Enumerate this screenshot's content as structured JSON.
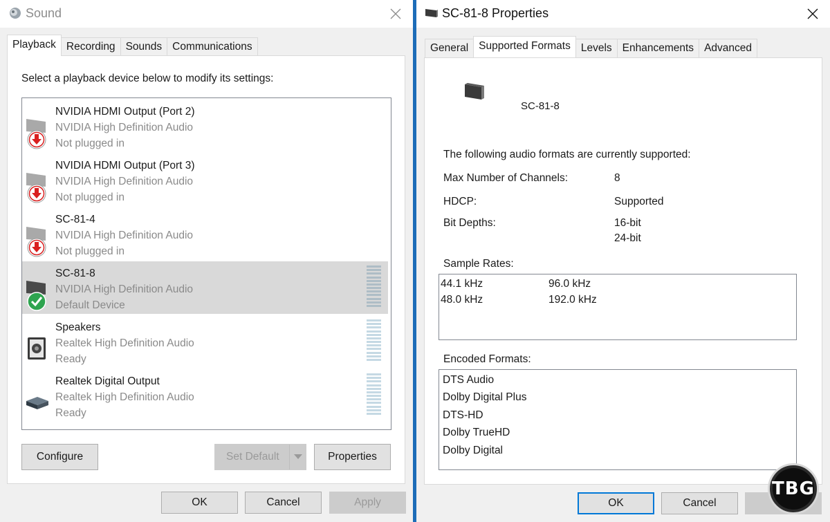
{
  "sound": {
    "title": "Sound",
    "tabs": [
      {
        "label": "Playback",
        "active": true
      },
      {
        "label": "Recording",
        "active": false
      },
      {
        "label": "Sounds",
        "active": false
      },
      {
        "label": "Communications",
        "active": false
      }
    ],
    "instruction": "Select a playback device below to modify its settings:",
    "devices": [
      {
        "name": "NVIDIA HDMI Output (Port 2)",
        "driver": "NVIDIA High Definition Audio",
        "status": "Not plugged in",
        "icon": "monitor-unplugged-icon",
        "selected": false
      },
      {
        "name": "NVIDIA HDMI Output (Port 3)",
        "driver": "NVIDIA High Definition Audio",
        "status": "Not plugged in",
        "icon": "monitor-unplugged-icon",
        "selected": false
      },
      {
        "name": "SC-81-4",
        "driver": "NVIDIA High Definition Audio",
        "status": "Not plugged in",
        "icon": "monitor-unplugged-icon",
        "selected": false
      },
      {
        "name": "SC-81-8",
        "driver": "NVIDIA High Definition Audio",
        "status": "Default Device",
        "icon": "monitor-default-icon",
        "selected": true
      },
      {
        "name": "Speakers",
        "driver": "Realtek High Definition Audio",
        "status": "Ready",
        "icon": "speaker-icon",
        "selected": false
      },
      {
        "name": "Realtek Digital Output",
        "driver": "Realtek High Definition Audio",
        "status": "Ready",
        "icon": "digital-output-icon",
        "selected": false
      }
    ],
    "buttons": {
      "configure": "Configure",
      "set_default": "Set Default",
      "properties": "Properties",
      "ok": "OK",
      "cancel": "Cancel",
      "apply": "Apply"
    }
  },
  "props": {
    "title": "SC-81-8 Properties",
    "tabs": [
      {
        "label": "General",
        "active": false
      },
      {
        "label": "Supported Formats",
        "active": true
      },
      {
        "label": "Levels",
        "active": false
      },
      {
        "label": "Enhancements",
        "active": false
      },
      {
        "label": "Advanced",
        "active": false
      }
    ],
    "device_name": "SC-81-8",
    "intro": "The following audio formats are currently supported:",
    "max_channels_label": "Max Number of Channels:",
    "max_channels_value": "8",
    "hdcp_label": "HDCP:",
    "hdcp_value": "Supported",
    "bit_depths_label": "Bit Depths:",
    "bit_depths": [
      "16-bit",
      "24-bit"
    ],
    "sample_rates_label": "Sample Rates:",
    "sample_rates": [
      "44.1 kHz",
      "96.0 kHz",
      "48.0 kHz",
      "192.0 kHz"
    ],
    "encoded_formats_label": "Encoded Formats:",
    "encoded_formats": [
      "DTS Audio",
      "Dolby Digital Plus",
      "DTS-HD",
      "Dolby TrueHD",
      "Dolby Digital"
    ],
    "buttons": {
      "ok": "OK",
      "cancel": "Cancel",
      "apply": "Ap"
    }
  },
  "watermark": "TBG",
  "colors": {
    "accent": "#0078d7",
    "unplugged": "#d91f1f",
    "default": "#2ea44f",
    "desktop": "#1c6cb8"
  }
}
